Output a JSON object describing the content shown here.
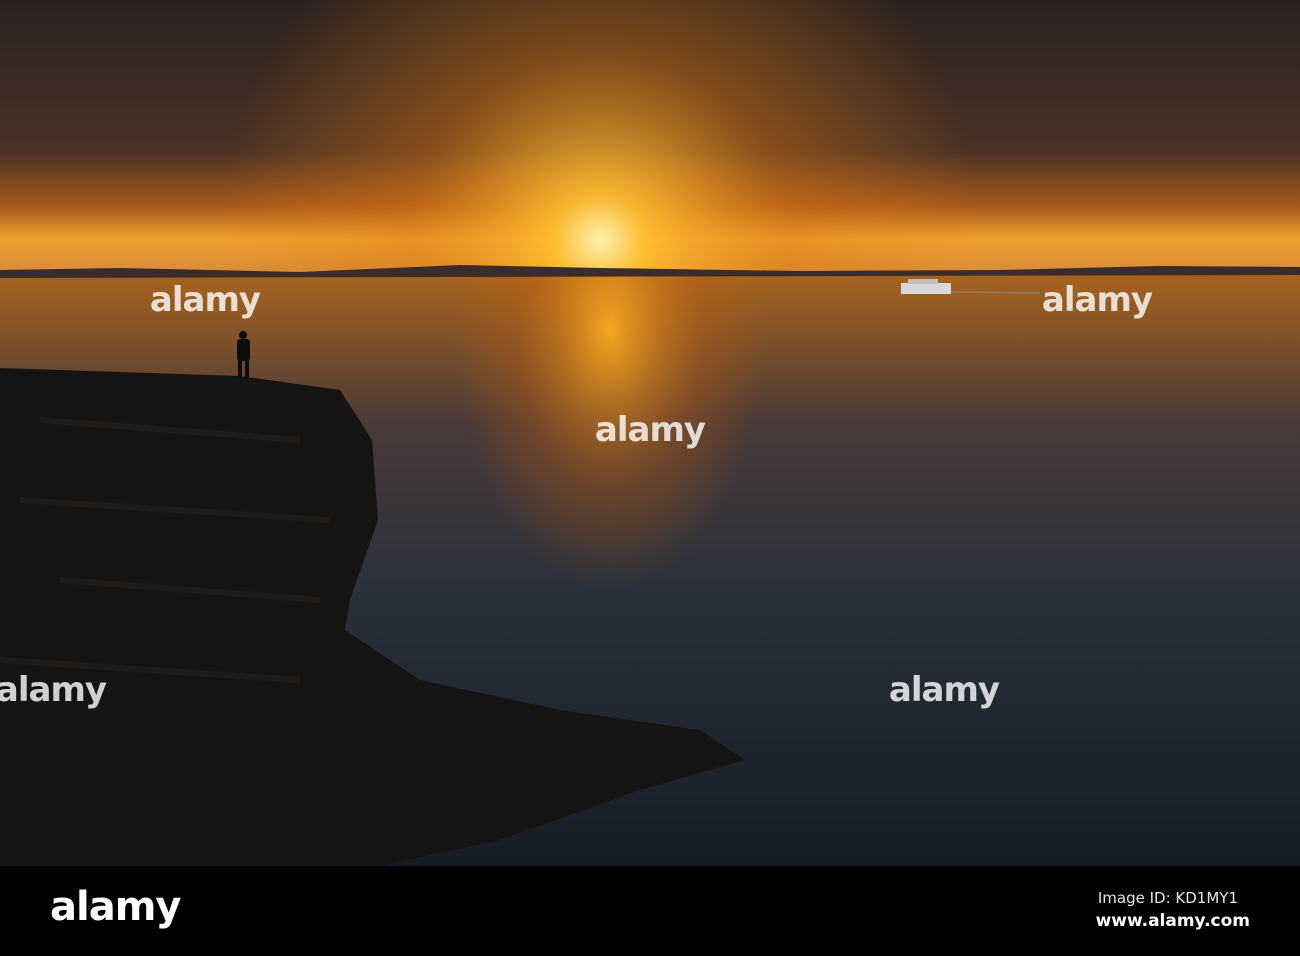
{
  "watermark": {
    "text": "alamy"
  },
  "footer": {
    "logo": "alamy",
    "image_id": "Image ID: KD1MY1",
    "website": "www.alamy.com"
  },
  "colors": {
    "sky_dark": "#2f2420",
    "sun_glow": "#f5a020",
    "sea_dark": "#1c2430",
    "bar": "#000000"
  }
}
